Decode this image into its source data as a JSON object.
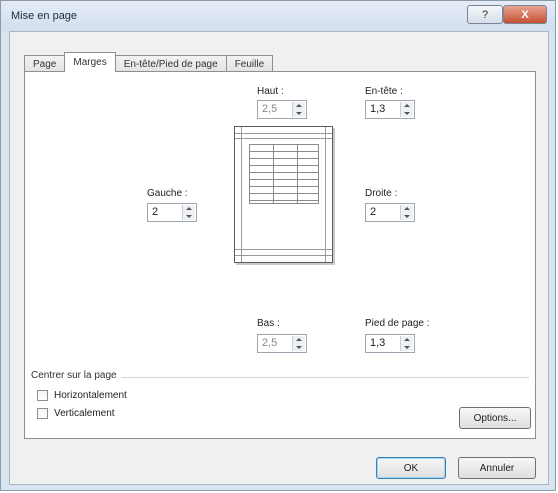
{
  "window": {
    "title": "Mise en page",
    "help_label": "?",
    "close_label": "X"
  },
  "tabs": [
    {
      "label": "Page",
      "active": false
    },
    {
      "label": "Marges",
      "active": true
    },
    {
      "label": "En-tête/Pied de page",
      "active": false
    },
    {
      "label": "Feuille",
      "active": false
    }
  ],
  "margins": {
    "top": {
      "label": "Haut :",
      "value": "2,5"
    },
    "header": {
      "label": "En-tête :",
      "value": "1,3"
    },
    "left": {
      "label": "Gauche :",
      "value": "2"
    },
    "right": {
      "label": "Droite :",
      "value": "2"
    },
    "bottom": {
      "label": "Bas :",
      "value": "2,5"
    },
    "footer": {
      "label": "Pied de page :",
      "value": "1,3"
    }
  },
  "center": {
    "title": "Centrer sur la page",
    "horizontal": "Horizontalement",
    "vertical": "Verticalement"
  },
  "buttons": {
    "options": "Options...",
    "ok": "OK",
    "cancel": "Annuler"
  }
}
